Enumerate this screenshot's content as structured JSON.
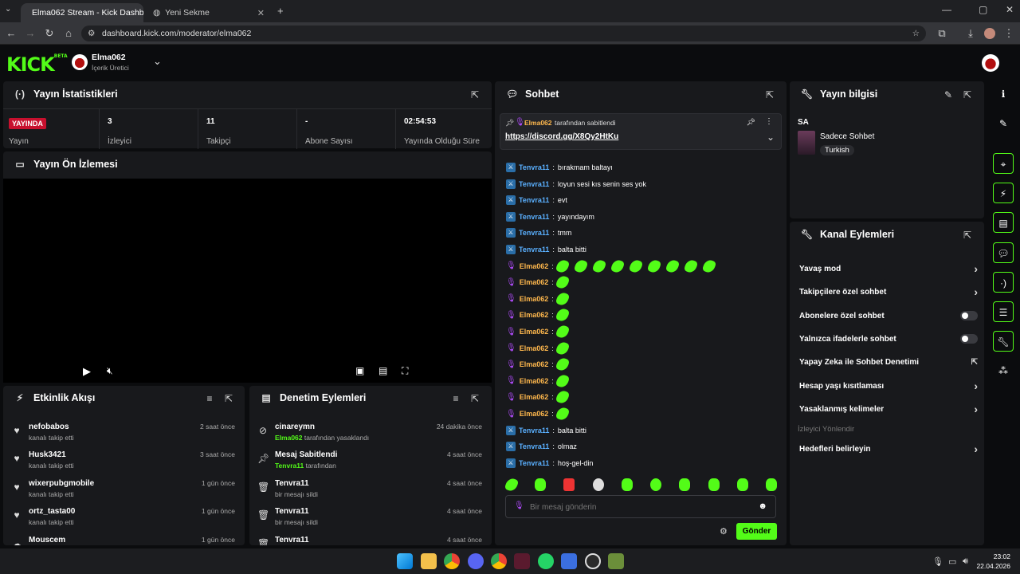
{
  "browser": {
    "tabs": [
      {
        "label": "Elma062 Stream - Kick Dashbo"
      },
      {
        "label": "Yeni Sekme"
      }
    ],
    "url": "dashboard.kick.com/moderator/elma062"
  },
  "header": {
    "logo": "KICK",
    "logo_tag": "BETA",
    "channel_name": "Elma062",
    "channel_role": "İçerik Üretici"
  },
  "stats": {
    "title": "Yayın İstatistikleri",
    "live_badge": "YAYINDA",
    "live_label": "Yayın",
    "items": [
      {
        "value": "3",
        "label": "İzleyici"
      },
      {
        "value": "11",
        "label": "Takipçi"
      },
      {
        "value": "-",
        "label": "Abone Sayısı"
      },
      {
        "value": "02:54:53",
        "label": "Yayında Olduğu Süre"
      }
    ]
  },
  "preview": {
    "title": "Yayın Ön İzlemesi"
  },
  "activity": {
    "title": "Etkinlik Akışı",
    "items": [
      {
        "name": "nefobabos",
        "sub": "kanalı takip etti",
        "time": "2 saat önce"
      },
      {
        "name": "Husk3421",
        "sub": "kanalı takip etti",
        "time": "3 saat önce"
      },
      {
        "name": "wixerpubgmobile",
        "sub": "kanalı takip etti",
        "time": "1 gün önce"
      },
      {
        "name": "ortz_tasta00",
        "sub": "kanalı takip etti",
        "time": "1 gün önce"
      },
      {
        "name": "Mouscem",
        "sub": "",
        "time": "1 gün önce"
      }
    ]
  },
  "moderation": {
    "title": "Denetim Eylemleri",
    "items": [
      {
        "name": "cinareymn",
        "sub_user": "Elma062",
        "sub": "tarafından yasaklandı",
        "time": "24 dakika önce"
      },
      {
        "name": "Mesaj Sabitlendi",
        "sub_user": "Tenvra11",
        "sub": "tarafından",
        "time": "4 saat önce"
      },
      {
        "name": "Tenvra11",
        "sub_user": "",
        "sub": "bir mesajı sildi",
        "time": "4 saat önce"
      },
      {
        "name": "Tenvra11",
        "sub_user": "",
        "sub": "bir mesajı sildi",
        "time": "4 saat önce"
      },
      {
        "name": "Tenvra11",
        "sub_user": "",
        "sub": "",
        "time": "4 saat önce"
      }
    ]
  },
  "chat": {
    "title": "Sohbet",
    "pinned_by": "Elma062",
    "pinned_text": "tarafından sabitlendi",
    "pinned_link": "https://discord.gg/X8Qy2HtKu",
    "messages": [
      {
        "user": "Tenvra11",
        "role": "mod",
        "text": "bırakmam baltayı"
      },
      {
        "user": "Tenvra11",
        "role": "mod",
        "text": "loyun sesi kıs senin ses yok"
      },
      {
        "user": "Tenvra11",
        "role": "mod",
        "text": "evt"
      },
      {
        "user": "Tenvra11",
        "role": "mod",
        "text": "yayındayım"
      },
      {
        "user": "Tenvra11",
        "role": "mod",
        "text": "tmm"
      },
      {
        "user": "Tenvra11",
        "role": "mod",
        "text": "balta bitti"
      },
      {
        "user": "Elma062",
        "role": "host",
        "emotes": 9
      },
      {
        "user": "Elma062",
        "role": "host",
        "emotes": 1
      },
      {
        "user": "Elma062",
        "role": "host",
        "emotes": 1
      },
      {
        "user": "Elma062",
        "role": "host",
        "emotes": 1
      },
      {
        "user": "Elma062",
        "role": "host",
        "emotes": 1
      },
      {
        "user": "Elma062",
        "role": "host",
        "emotes": 1
      },
      {
        "user": "Elma062",
        "role": "host",
        "emotes": 1
      },
      {
        "user": "Elma062",
        "role": "host",
        "emotes": 1
      },
      {
        "user": "Elma062",
        "role": "host",
        "emotes": 1
      },
      {
        "user": "Elma062",
        "role": "host",
        "emotes": 1
      },
      {
        "user": "Tenvra11",
        "role": "mod",
        "text": "balta bitti"
      },
      {
        "user": "Tenvra11",
        "role": "mod",
        "text": "olmaz"
      },
      {
        "user": "Tenvra11",
        "role": "mod",
        "text": "hoş-gel-din"
      }
    ],
    "input_placeholder": "Bir mesaj gönderin",
    "send_label": "Gönder"
  },
  "stream_info": {
    "title": "Yayın bilgisi",
    "stream_title": "SA",
    "category": "Sadece Sohbet",
    "language": "Turkish"
  },
  "channel_actions": {
    "title": "Kanal Eylemleri",
    "items": [
      {
        "label": "Yavaş mod",
        "control": "chevron"
      },
      {
        "label": "Takipçilere özel sohbet",
        "control": "chevron"
      },
      {
        "label": "Abonelere özel sohbet",
        "control": "toggle"
      },
      {
        "label": "Yalnızca ifadelerle sohbet",
        "control": "toggle"
      },
      {
        "label": "Yapay Zeka ile Sohbet Denetimi",
        "control": "external"
      },
      {
        "label": "Hesap yaşı kısıtlaması",
        "control": "chevron"
      },
      {
        "label": "Yasaklanmış kelimeler",
        "control": "chevron"
      }
    ],
    "section": "İzleyici Yönlendir",
    "targets": "Hedefleri belirleyin"
  },
  "taskbar": {
    "time": "23:02",
    "date": "22.04.2026"
  },
  "colors": {
    "accent": "#53fc18",
    "live": "#c8102e",
    "mod_username": "#5ab0ff",
    "host_username": "#ffb84d"
  }
}
